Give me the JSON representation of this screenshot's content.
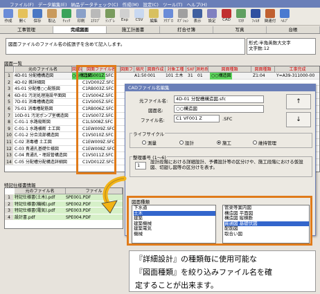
{
  "menu": [
    "ファイル(F)",
    "データ編集(E)",
    "納品データチェック(C)",
    "作成(M)",
    "設定(C)",
    "ツール(T)",
    "ヘルプ(H)"
  ],
  "toolbar": [
    {
      "label": "作成",
      "color": "#6a8cd8"
    },
    {
      "label": "開く",
      "color": "#e5c15a"
    },
    {
      "label": "保存",
      "color": "#4a78c4"
    },
    {
      "label": "取込",
      "color": "#c99a5c"
    },
    {
      "label": "ﾁｪｯｸ",
      "color": "#3ba35b"
    },
    {
      "label": "印刷",
      "color": "#8aa0c8"
    },
    {
      "label": "ｴｸｽﾌﾟ",
      "color": "#b9b9b9"
    },
    {
      "label": "ﾃﾝﾌﾟﾚ",
      "color": "#7a9c5e"
    },
    {
      "label": "Exp",
      "color": "#d0d0d0"
    },
    {
      "label": "CSV",
      "color": "#c8d8f0"
    },
    {
      "label": "編集",
      "color": "#d8c060"
    },
    {
      "label": "ｱｸﾌﾟﾛ",
      "color": "#6a8cd8"
    },
    {
      "label": "ｵﾌﾟｼｮﾝ",
      "color": "#a0a0a0"
    },
    {
      "label": "表示",
      "color": "#4060a0"
    },
    {
      "label": "設定",
      "color": "#8080c0"
    },
    {
      "label": "CAD",
      "color": "#c03030"
    },
    {
      "label": "ﾏｽﾀ",
      "color": "#60a060"
    },
    {
      "label": "ﾌｨﾙﾀ",
      "color": "#3050a0"
    },
    {
      "label": "関連付",
      "color": "#c06030"
    },
    {
      "label": "ﾍﾙﾌﾟ",
      "color": "#4a7ad0"
    }
  ],
  "tabs": [
    "工事管理",
    "完成図面",
    "施工計画書",
    "打合せ簿",
    "写真",
    "台帳"
  ],
  "active_tab": 1,
  "remark_text": "図面ファイルのファイル名の拡張子を含めて記入します。",
  "right_hint": "形式:半角英数大文字\n文字数:12",
  "list_label": "図面一覧",
  "columns": [
    "元のファイル名",
    "図面名",
    "図面ファイル名",
    "図面ファ",
    "縮尺",
    "図面作成",
    "対象工種",
    "SXF",
    "測地系",
    "図面種類",
    "図面種類",
    "工事完成"
  ],
  "rows": [
    {
      "n": "1",
      "orig": "4D-01 分配槽構造図",
      "mark": "○○構造図",
      "file": "C1VS001Z.SFC"
    },
    {
      "n": "2",
      "orig": "4D-02 雑詳細図",
      "mark": "",
      "file": "C1VD002Z.SFC"
    },
    {
      "n": "3",
      "orig": "4S-01 分配槽○○配筋図",
      "mark": "",
      "file": "C1RB003Z.SFC"
    },
    {
      "n": "4",
      "orig": "6D-01 汚泥処理施設平面図",
      "mark": "",
      "file": "C1VS004Z.SFC"
    },
    {
      "n": "5",
      "orig": "7D-01 消毒槽構造図",
      "mark": "",
      "file": "C1VS005Z.SFC"
    },
    {
      "n": "6",
      "orig": "7S-01 消毒槽配筋図",
      "mark": "",
      "file": "C1RB006Z.SFC"
    },
    {
      "n": "7",
      "orig": "10D-01 汚泥ポンプ室構造図",
      "mark": "",
      "file": "C1VS007Z.SFC"
    },
    {
      "n": "8",
      "orig": "C-01-1 水路縦断図",
      "mark": "",
      "file": "C1LS008Z.SFC"
    },
    {
      "n": "9",
      "orig": "C-01-1 水路横断 土工図",
      "mark": "",
      "file": "C1EW009Z.SFC"
    },
    {
      "n": "10",
      "orig": "C-01-2 分合流部構造図",
      "mark": "",
      "file": "C1VS010Z.SFC"
    },
    {
      "n": "11",
      "orig": "C-02 消毒槽 土工図",
      "mark": "",
      "file": "C1EW009Z.SFC"
    },
    {
      "n": "12",
      "orig": "C-03 貴通孔基礎仕様図",
      "mark": "",
      "file": "C1EW008Z.SFC"
    },
    {
      "n": "13",
      "orig": "C-04 貴通孔・埋設管構造図",
      "mark": "",
      "file": "C1VS011Z.SFC"
    },
    {
      "n": "14",
      "orig": "C-05 分配槽分配構造詳細図",
      "mark": "",
      "file": "C1VD012Z.SFC"
    }
  ],
  "row1_extra": {
    "scale": "A1:50",
    "date": "001",
    "kind": "101 土木",
    "sxf": "31",
    "geo": "01",
    "type1": "○○構造図",
    "type2": "Z1:04",
    "final": "Y=A39-311000-00"
  },
  "spec_label": "特記仕様書情報",
  "spec_columns": [
    "元のファイル名",
    "ファイル"
  ],
  "spec_rows": [
    {
      "n": "1",
      "orig": "特記仕様書(土木).pdf",
      "file": "SPE001.PDF"
    },
    {
      "n": "2",
      "orig": "特記仕様書(機械).pdf",
      "file": "SPE002.PDF"
    },
    {
      "n": "3",
      "orig": "特記仕様書(電気).pdf",
      "file": "SPE003.PDF"
    },
    {
      "n": "4",
      "orig": "設計書.pdf",
      "file": "SPE004.PDF"
    }
  ],
  "dialog": {
    "title": "CADファイル名編集",
    "orig_label": "元ファイル名:",
    "orig_value": "4D-01 分配槽構造図.sfc",
    "name_label": "図面名:",
    "name_value": "○○構造図",
    "file_label": "ファイル名:",
    "file_value": "C1 VF001 Z",
    "ext": ".SFC",
    "up": "↑",
    "down": "↓",
    "lifecycle_label": "ライフサイクル",
    "lifecycle": [
      "測量",
      "設計",
      "施工",
      "維持管理"
    ],
    "lifecycle_selected": 2,
    "seq_label": "整理番号 (1〜6)",
    "seq_value": "1",
    "seq_note": "設計段階における詳細設計、予備設計等の区分けや、施工段階における仮設図、切廻し図等の区分けを表す。"
  },
  "type_box": {
    "label": "図面種類",
    "left_items": [
      "下水道",
      "土木",
      "建築",
      "建築機械",
      "建築電気",
      "機械"
    ],
    "left_selected": 1,
    "right_items": [
      "管渠等案内図",
      "構造図 平面図",
      "構造図 縦横断",
      "貫通図 基礎伏図",
      "配筋図",
      "取合い図"
    ],
    "right_selected": 3
  },
  "callout": [
    "『詳細設計』の種類毎に使用可能な",
    "『図面種類』を絞り込みファイル名を確",
    "定することが出来ます。"
  ],
  "accent": "#e07b1a"
}
